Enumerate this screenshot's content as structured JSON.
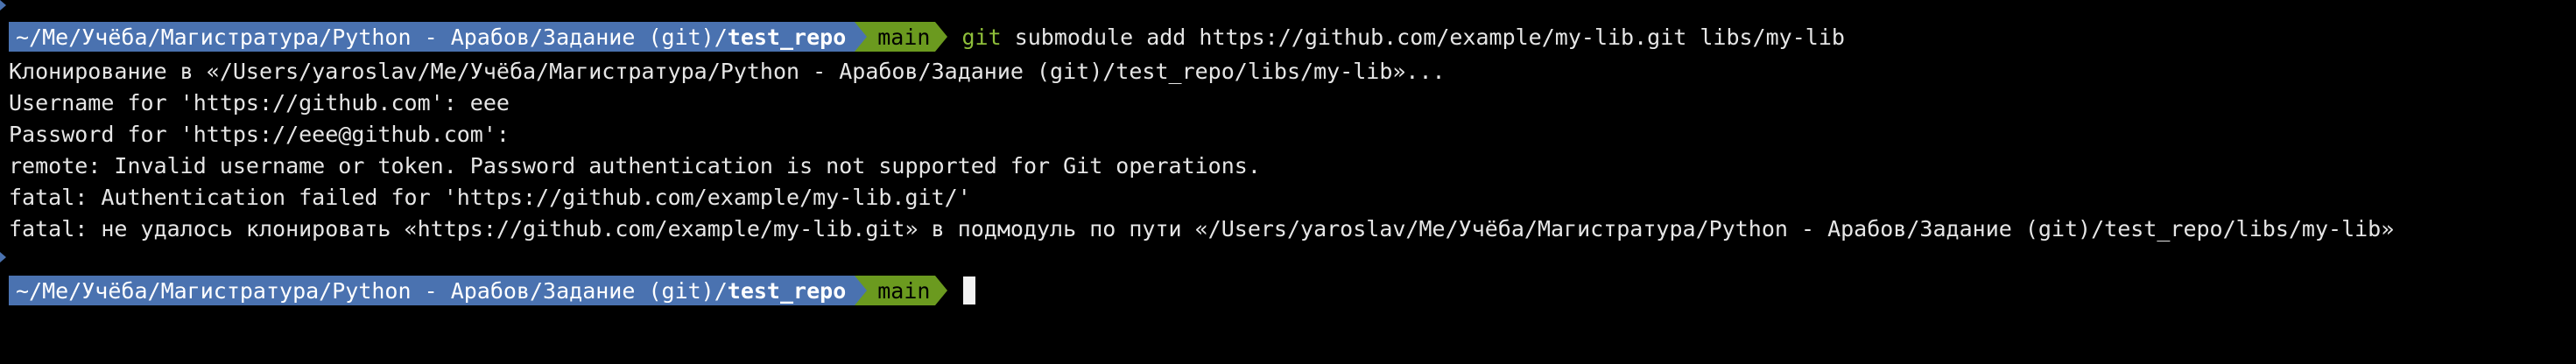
{
  "prompt1": {
    "path_prefix": "~/Me/Учёба/Магистратура/Python - Арабов/Задание (git)/",
    "path_dir": "test_repo",
    "branch": "main",
    "command_git": "git",
    "command_rest": "submodule add https://github.com/example/my-lib.git libs/my-lib"
  },
  "output": [
    "Клонирование в «/Users/yaroslav/Me/Учёба/Магистратура/Python - Арабов/Задание (git)/test_repo/libs/my-lib»...",
    "Username for 'https://github.com': eee",
    "Password for 'https://eee@github.com':",
    "remote: Invalid username or token. Password authentication is not supported for Git operations.",
    "fatal: Authentication failed for 'https://github.com/example/my-lib.git/'",
    "fatal: не удалось клонировать «https://github.com/example/my-lib.git» в подмодуль по пути «/Users/yaroslav/Me/Учёба/Магистратура/Python - Арабов/Задание (git)/test_repo/libs/my-lib»"
  ],
  "prompt2": {
    "path_prefix": "~/Me/Учёба/Магистратура/Python - Арабов/Задание (git)/",
    "path_dir": "test_repo",
    "branch": "main"
  },
  "colors": {
    "path_bg": "#4a72b0",
    "branch_bg": "#6b9a1f",
    "git_keyword": "#8fbf3a",
    "background": "#000000"
  }
}
